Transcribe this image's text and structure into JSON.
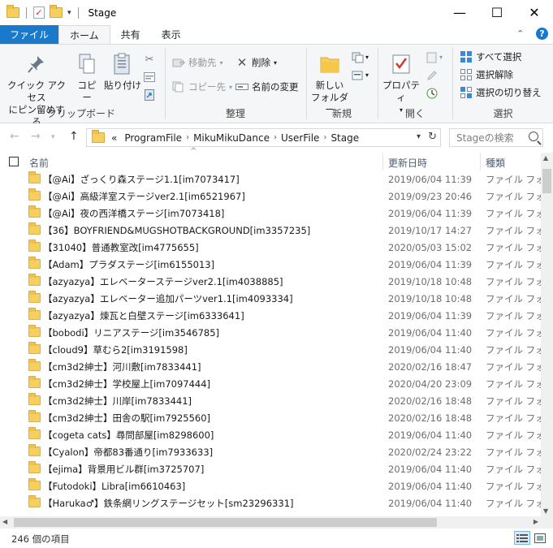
{
  "window": {
    "title": "Stage",
    "minimize_glyph": "—",
    "maximize_glyph": "☐",
    "close_glyph": "✕"
  },
  "tabs": {
    "file": "ファイル",
    "home": "ホーム",
    "share": "共有",
    "view": "表示"
  },
  "ribbon": {
    "clipboard": {
      "label": "クリップボード",
      "pin_line1": "クイック アクセス",
      "pin_line2": "にピン留めする",
      "copy": "コピー",
      "paste": "貼り付け"
    },
    "organize": {
      "label": "整理",
      "move_to": "移動先",
      "copy_to": "コピー先",
      "delete": "削除",
      "rename": "名前の変更"
    },
    "new": {
      "label": "新規",
      "new_folder_line1": "新しい",
      "new_folder_line2": "フォルダー"
    },
    "open": {
      "label": "開く",
      "properties": "プロパティ"
    },
    "select": {
      "label": "選択",
      "select_all": "すべて選択",
      "select_none": "選択解除",
      "invert": "選択の切り替え"
    }
  },
  "address": {
    "overflow": "«",
    "crumbs": [
      "ProgramFile",
      "MikuMikuDance",
      "UserFile",
      "Stage"
    ],
    "search_placeholder": "Stageの検索"
  },
  "columns": {
    "name": "名前",
    "date": "更新日時",
    "type": "種類"
  },
  "files": [
    {
      "name": "【@Ai】ざっくり森ステージ1.1[im7073417]",
      "date": "2019/06/04 11:39",
      "type": "ファイル フォルダー"
    },
    {
      "name": "【@Ai】高級洋室ステージver2.1[im6521967]",
      "date": "2019/09/23 20:46",
      "type": "ファイル フォルダー"
    },
    {
      "name": "【@Ai】夜の西洋橋ステージ[im7073418]",
      "date": "2019/06/04 11:39",
      "type": "ファイル フォルダー"
    },
    {
      "name": "【36】BOYFRIEND&MUGSHOTBACKGROUND[im3357235]",
      "date": "2019/10/17 14:27",
      "type": "ファイル フォルダー"
    },
    {
      "name": "【31040】普通教室改[im4775655]",
      "date": "2020/05/03 15:02",
      "type": "ファイル フォルダー"
    },
    {
      "name": "【Adam】プラダステージ[im6155013]",
      "date": "2019/06/04 11:39",
      "type": "ファイル フォルダー"
    },
    {
      "name": "【azyazya】エレベーターステージver2.1[im4038885]",
      "date": "2019/10/18 10:48",
      "type": "ファイル フォルダー"
    },
    {
      "name": "【azyazya】エレベーター追加パーツver1.1[im4093334]",
      "date": "2019/10/18 10:48",
      "type": "ファイル フォルダー"
    },
    {
      "name": "【azyazya】煉瓦と白壁ステージ[im6333641]",
      "date": "2019/06/04 11:39",
      "type": "ファイル フォルダー"
    },
    {
      "name": "【bobodi】リニアステージ[im3546785]",
      "date": "2019/06/04 11:40",
      "type": "ファイル フォルダー"
    },
    {
      "name": "【cloud9】草むら2[im3191598]",
      "date": "2019/06/04 11:40",
      "type": "ファイル フォルダー"
    },
    {
      "name": "【cm3d2紳士】河川敷[im7833441]",
      "date": "2020/02/16 18:47",
      "type": "ファイル フォルダー"
    },
    {
      "name": "【cm3d2紳士】学校屋上[im7097444]",
      "date": "2020/04/20 23:09",
      "type": "ファイル フォルダー"
    },
    {
      "name": "【cm3d2紳士】川岸[im7833441]",
      "date": "2020/02/16 18:48",
      "type": "ファイル フォルダー"
    },
    {
      "name": "【cm3d2紳士】田舎の駅[im7925560]",
      "date": "2020/02/16 18:48",
      "type": "ファイル フォルダー"
    },
    {
      "name": "【cogeta cats】尋問部屋[im8298600]",
      "date": "2019/06/04 11:40",
      "type": "ファイル フォルダー"
    },
    {
      "name": "【Cyalon】帝都83番通り[im7933633]",
      "date": "2020/02/24 23:22",
      "type": "ファイル フォルダー"
    },
    {
      "name": "【ejima】背景用ビル群[im3725707]",
      "date": "2019/06/04 11:40",
      "type": "ファイル フォルダー"
    },
    {
      "name": "【Futodoki】Libra[im6610463]",
      "date": "2019/06/04 11:40",
      "type": "ファイル フォルダー"
    },
    {
      "name": "【Haruka♂】鉄条網リングステージセット[sm23296331]",
      "date": "2019/06/04 11:40",
      "type": "ファイル フォルダー"
    }
  ],
  "status": {
    "item_count": "246 個の項目"
  },
  "colors": {
    "file_tab": "#1979ca",
    "folder": "#f7cf5e",
    "header_text": "#4c607a"
  }
}
